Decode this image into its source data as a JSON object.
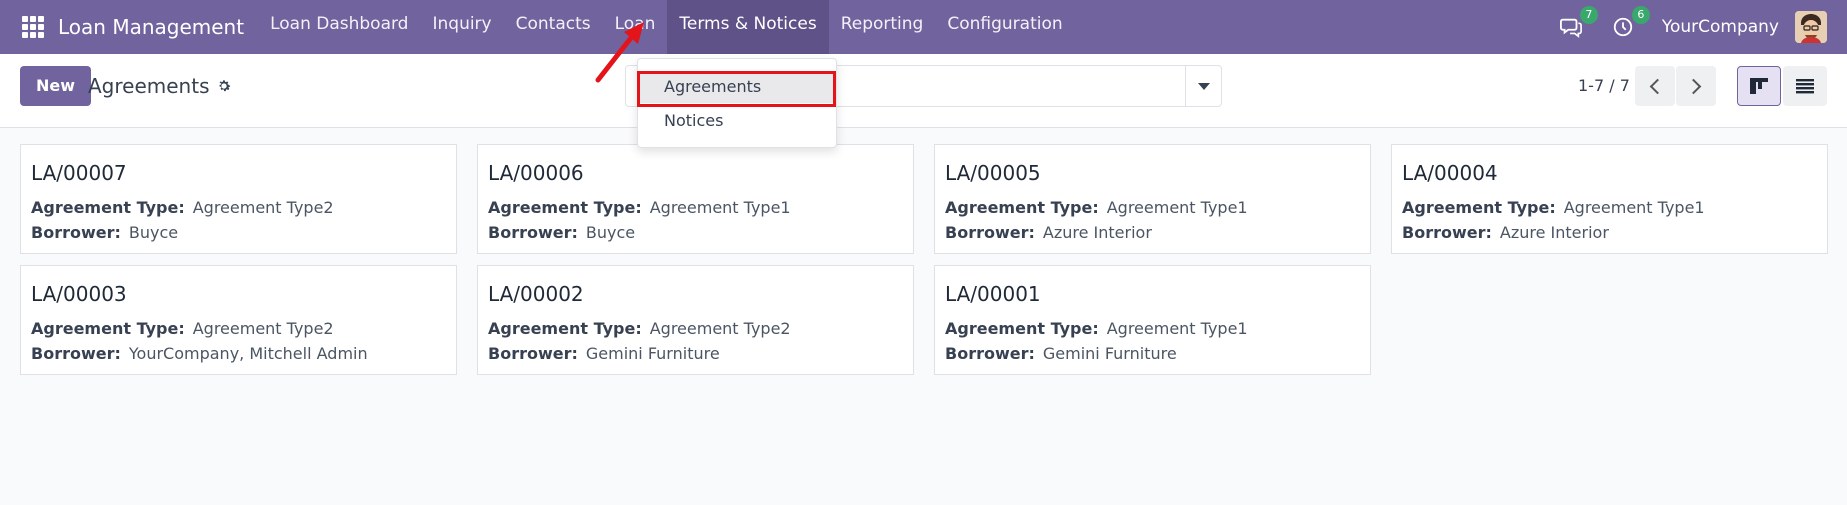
{
  "navbar": {
    "app_name": "Loan Management",
    "menu": [
      {
        "label": "Loan Dashboard"
      },
      {
        "label": "Inquiry"
      },
      {
        "label": "Contacts"
      },
      {
        "label": "Loan"
      },
      {
        "label": "Terms & Notices",
        "active": true
      },
      {
        "label": "Reporting"
      },
      {
        "label": "Configuration"
      }
    ],
    "messages_count": "7",
    "activities_count": "6",
    "company": "YourCompany",
    "color": "#71639e"
  },
  "control": {
    "new_label": "New",
    "breadcrumb": "Agreements",
    "pager": "1-7 / 7"
  },
  "dropdown": {
    "items": [
      {
        "label": "Agreements"
      },
      {
        "label": "Notices"
      }
    ]
  },
  "cards": [
    {
      "title": "LA/00007",
      "type_label": "Agreement Type:",
      "type": "Agreement Type2",
      "borrower_label": "Borrower:",
      "borrower": "Buyce"
    },
    {
      "title": "LA/00006",
      "type_label": "Agreement Type:",
      "type": "Agreement Type1",
      "borrower_label": "Borrower:",
      "borrower": "Buyce"
    },
    {
      "title": "LA/00005",
      "type_label": "Agreement Type:",
      "type": "Agreement Type1",
      "borrower_label": "Borrower:",
      "borrower": "Azure Interior"
    },
    {
      "title": "LA/00004",
      "type_label": "Agreement Type:",
      "type": "Agreement Type1",
      "borrower_label": "Borrower:",
      "borrower": "Azure Interior"
    },
    {
      "title": "LA/00003",
      "type_label": "Agreement Type:",
      "type": "Agreement Type2",
      "borrower_label": "Borrower:",
      "borrower": "YourCompany, Mitchell Admin"
    },
    {
      "title": "LA/00002",
      "type_label": "Agreement Type:",
      "type": "Agreement Type2",
      "borrower_label": "Borrower:",
      "borrower": "Gemini Furniture"
    },
    {
      "title": "LA/00001",
      "type_label": "Agreement Type:",
      "type": "Agreement Type1",
      "borrower_label": "Borrower:",
      "borrower": "Gemini Furniture"
    }
  ]
}
